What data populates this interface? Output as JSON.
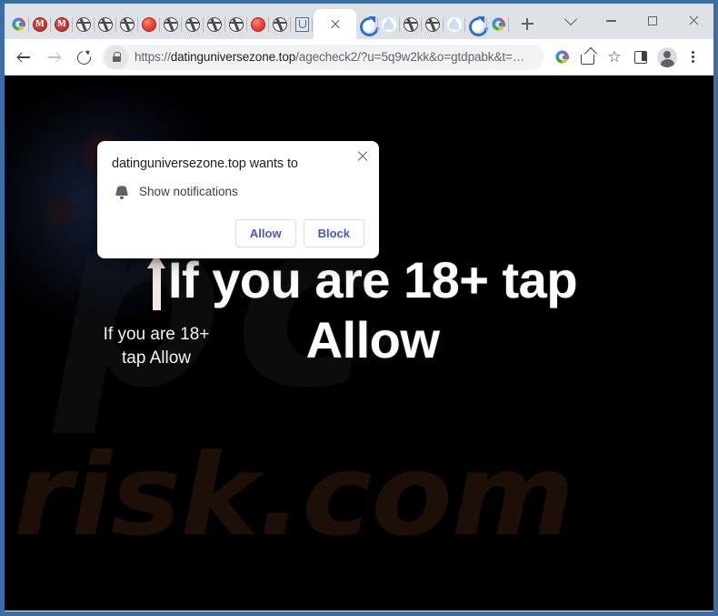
{
  "browser": {
    "tabs": [
      {
        "icon": "google-favicon",
        "type": "google"
      },
      {
        "icon": "red-m-favicon",
        "type": "m",
        "letter": "M"
      },
      {
        "icon": "red-m-favicon",
        "type": "m",
        "letter": "M"
      },
      {
        "icon": "globe-favicon",
        "type": "globe"
      },
      {
        "icon": "globe-favicon",
        "type": "globe"
      },
      {
        "icon": "globe-favicon",
        "type": "globe"
      },
      {
        "icon": "red-ball-favicon",
        "type": "redball"
      },
      {
        "icon": "globe-favicon",
        "type": "globe"
      },
      {
        "icon": "globe-favicon",
        "type": "globe"
      },
      {
        "icon": "globe-favicon",
        "type": "globe"
      },
      {
        "icon": "globe-favicon",
        "type": "globe"
      },
      {
        "icon": "red-ball-favicon",
        "type": "redball"
      },
      {
        "icon": "globe-favicon",
        "type": "globe"
      },
      {
        "icon": "shield-favicon",
        "type": "shield"
      }
    ],
    "active_tab": {
      "close_label": "Close tab"
    },
    "tabs_after": [
      {
        "icon": "chrome-favicon",
        "type": "chrome"
      },
      {
        "icon": "light-flame-favicon",
        "type": "light"
      },
      {
        "icon": "globe-favicon",
        "type": "globe"
      },
      {
        "icon": "globe-favicon",
        "type": "globe"
      },
      {
        "icon": "light-flame-favicon",
        "type": "light"
      },
      {
        "icon": "chrome-favicon",
        "type": "chrome"
      },
      {
        "icon": "google-favicon",
        "type": "google"
      }
    ],
    "new_tab_label": "New tab",
    "window_controls": {
      "tab_search": "tab-search-icon",
      "minimize": "minimize-icon",
      "maximize": "maximize-icon",
      "close": "close-icon"
    },
    "toolbar": {
      "back": "back-arrow-icon",
      "forward": "forward-arrow-icon",
      "reload": "reload-icon",
      "lock": "lock-icon",
      "url_scheme": "https://",
      "url_host": "datinguniversezone.top",
      "url_path": "/agecheck2/?u=5q9w2kk&o=gtdpabk&t=…",
      "url_full": "https://datinguniversezone.top/agecheck2/?u=5q9w2kk&o=gtdpabk&t=…",
      "google_icon": "google-icon",
      "share_icon": "share-icon",
      "bookmark_icon": "star-icon",
      "side_panel_icon": "side-panel-icon",
      "profile_icon": "avatar-icon",
      "menu_icon": "three-dot-menu-icon",
      "star_glyph": "☆"
    }
  },
  "dialog": {
    "title": "datinguniversezone.top wants to",
    "permission_label": "Show notifications",
    "permission_icon": "bell-icon",
    "allow_label": "Allow",
    "block_label": "Block",
    "close_label": "×"
  },
  "page": {
    "headline": "If you are 18+ tap Allow",
    "sub_callout": "If you are 18+ tap Allow",
    "arrow": "up-arrow-icon",
    "watermark_primary": "pc",
    "watermark_secondary": "risk.com",
    "background_color": "#000000"
  },
  "colors": {
    "window_frame": "#3a6ea5",
    "tabstrip_bg": "#dee1e6",
    "toolbar_bg": "#ffffff",
    "omnibox_bg": "#f1f3f4",
    "page_bg": "#000000",
    "dialog_button_text": "#4457c4",
    "headline_text": "#ffffff",
    "watermark_risk": "#1d0f08"
  }
}
